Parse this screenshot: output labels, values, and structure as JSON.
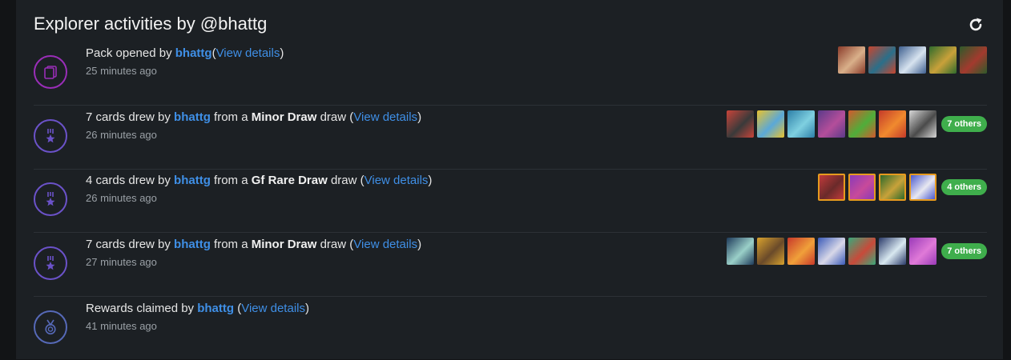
{
  "header": {
    "title": "Explorer activities by @bhattg",
    "refresh_icon": "refresh-icon"
  },
  "activities": [
    {
      "type": "pack",
      "icon": "cards-stack-icon",
      "prefix": "Pack opened by ",
      "user": "bhattg",
      "mid": "",
      "draw_name": "",
      "suffix": "",
      "link": "View details",
      "time": "25 minutes ago",
      "cards": [
        {
          "c1": "#8a3b2a",
          "c2": "#d9b08a",
          "gold": false
        },
        {
          "c1": "#c8452e",
          "c2": "#2a6f8a",
          "gold": false
        },
        {
          "c1": "#3e5f8f",
          "c2": "#d7e3ef",
          "gold": false
        },
        {
          "c1": "#2f6b2c",
          "c2": "#c9a13a",
          "gold": false
        },
        {
          "c1": "#2e5a2a",
          "c2": "#a33a2e",
          "gold": false
        }
      ],
      "others": ""
    },
    {
      "type": "draw",
      "icon": "medal-star-icon",
      "prefix": "7 cards drew by ",
      "user": "bhattg",
      "mid": " from a ",
      "draw_name": "Minor Draw",
      "suffix": " draw ",
      "link": "View details",
      "time": "26 minutes ago",
      "cards": [
        {
          "c1": "#c9443a",
          "c2": "#3a3a3a",
          "gold": false
        },
        {
          "c1": "#e8c22e",
          "c2": "#5aa8d8",
          "gold": false
        },
        {
          "c1": "#2d7fa8",
          "c2": "#7fd0e0",
          "gold": false
        },
        {
          "c1": "#5b3a8a",
          "c2": "#b44e9a",
          "gold": false
        },
        {
          "c1": "#d2592e",
          "c2": "#4fae3a",
          "gold": false
        },
        {
          "c1": "#c43a2a",
          "c2": "#f08a2e",
          "gold": false
        },
        {
          "c1": "#d8d8d8",
          "c2": "#4a4a4a",
          "gold": false
        }
      ],
      "others": "7 others"
    },
    {
      "type": "draw",
      "icon": "medal-star-icon",
      "prefix": "4 cards drew by ",
      "user": "bhattg",
      "mid": " from a ",
      "draw_name": "Gf Rare Draw",
      "suffix": " draw ",
      "link": "View details",
      "time": "26 minutes ago",
      "cards": [
        {
          "c1": "#c03a3a",
          "c2": "#6a2a2a",
          "gold": true
        },
        {
          "c1": "#8a3ab8",
          "c2": "#c84a9a",
          "gold": true
        },
        {
          "c1": "#2e6a2a",
          "c2": "#c8a23a",
          "gold": true
        },
        {
          "c1": "#4a5ad0",
          "c2": "#e8e8f0",
          "gold": true
        }
      ],
      "others": "4 others"
    },
    {
      "type": "draw",
      "icon": "medal-star-icon",
      "prefix": "7 cards drew by ",
      "user": "bhattg",
      "mid": " from a ",
      "draw_name": "Minor Draw",
      "suffix": " draw ",
      "link": "View details",
      "time": "27 minutes ago",
      "cards": [
        {
          "c1": "#1e3a5a",
          "c2": "#9ad0c8",
          "gold": false
        },
        {
          "c1": "#d8a22e",
          "c2": "#6a4a2a",
          "gold": false
        },
        {
          "c1": "#c8382a",
          "c2": "#f0a03a",
          "gold": false
        },
        {
          "c1": "#3a5ab8",
          "c2": "#d8d8e8",
          "gold": false
        },
        {
          "c1": "#3aa87a",
          "c2": "#c84a3a",
          "gold": false
        },
        {
          "c1": "#2a3a6a",
          "c2": "#d8e8f0",
          "gold": false
        },
        {
          "c1": "#9a3ab8",
          "c2": "#e07ad8",
          "gold": false
        }
      ],
      "others": "7 others"
    },
    {
      "type": "reward",
      "icon": "reward-medal-icon",
      "prefix": "Rewards claimed by ",
      "user": "bhattg",
      "mid": "",
      "draw_name": "",
      "suffix": " ",
      "link": "View details",
      "time": "41 minutes ago",
      "cards": [],
      "others": ""
    }
  ],
  "colors": {
    "link": "#3f8fe6",
    "others_badge": "#3fae4c",
    "gold_border": "#e69a1e"
  }
}
